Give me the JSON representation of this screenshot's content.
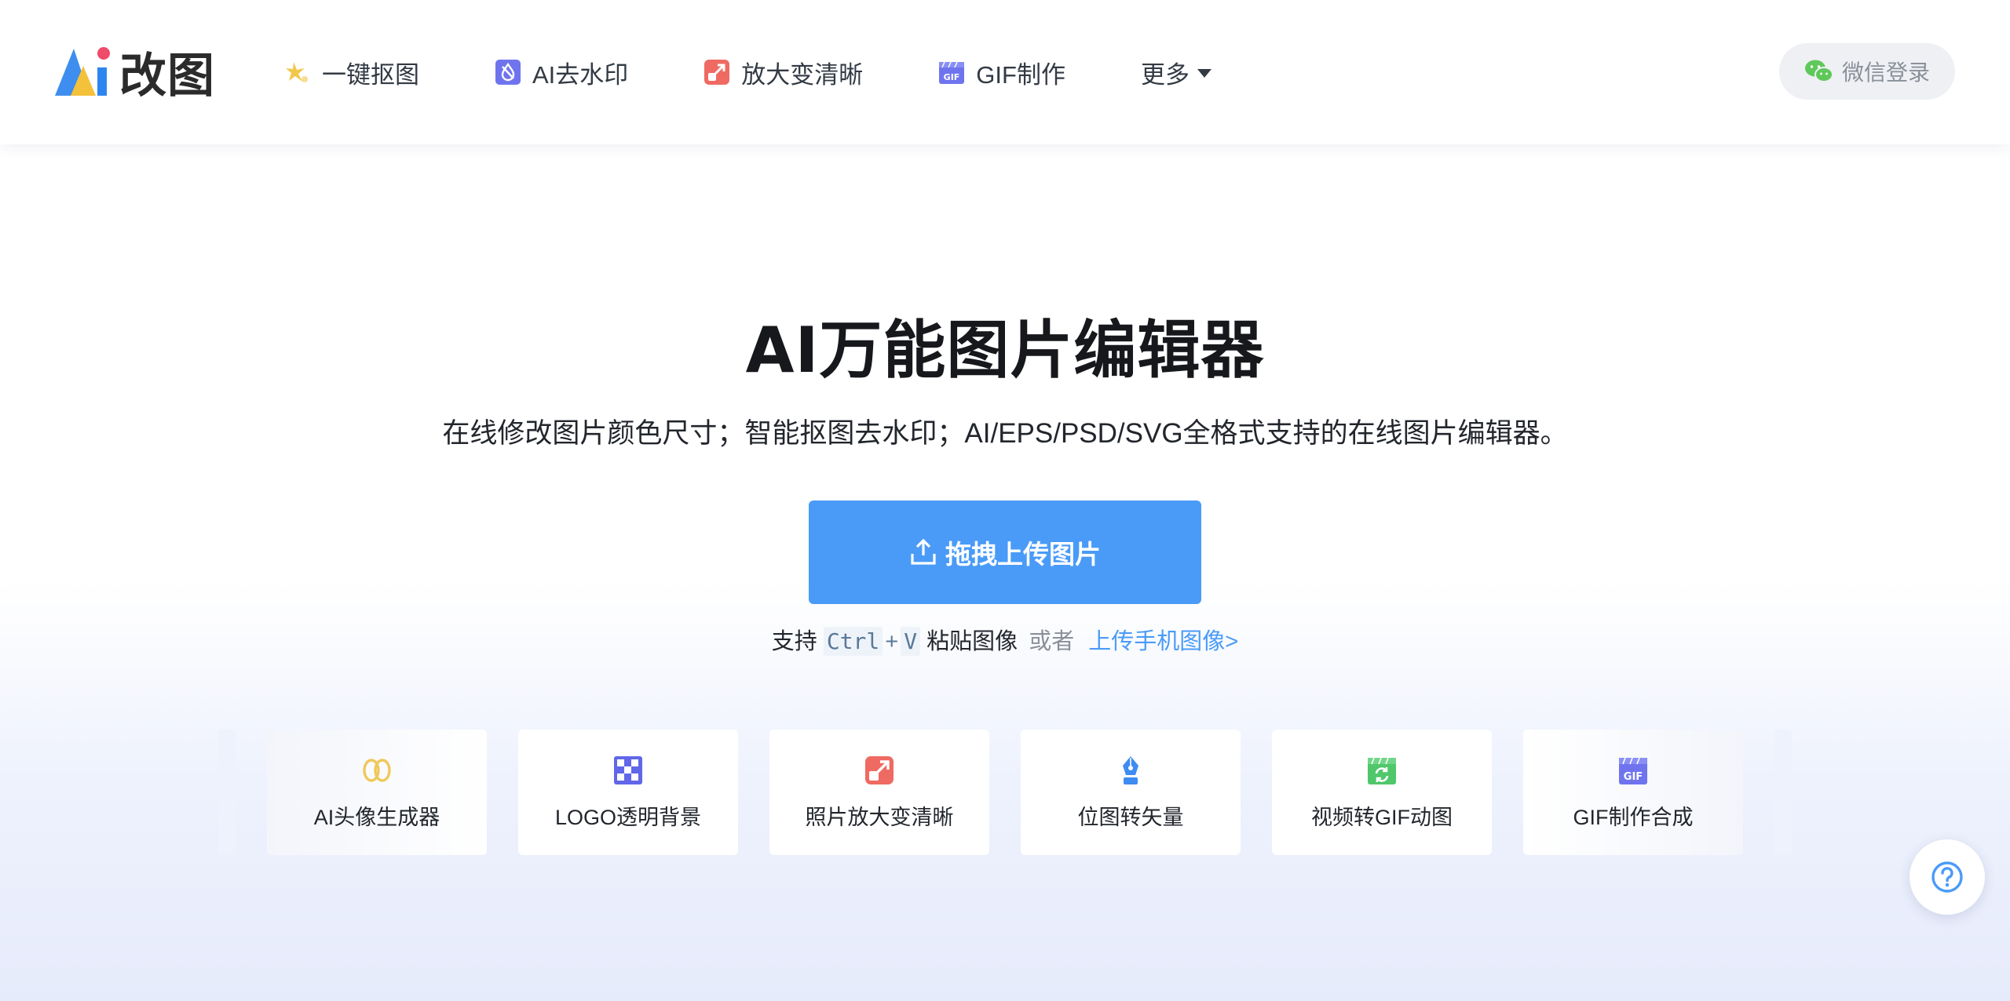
{
  "header": {
    "logo_text": "改图",
    "nav": [
      {
        "label": "一键抠图",
        "icon": "cutout-icon"
      },
      {
        "label": "AI去水印",
        "icon": "watermark-icon"
      },
      {
        "label": "放大变清晰",
        "icon": "enlarge-icon"
      },
      {
        "label": "GIF制作",
        "icon": "gif-icon"
      }
    ],
    "more_label": "更多",
    "login_label": "微信登录"
  },
  "hero": {
    "title": "AI万能图片编辑器",
    "subtitle": "在线修改图片颜色尺寸；智能抠图去水印；AI/EPS/PSD/SVG全格式支持的在线图片编辑器。",
    "upload_label": "拖拽上传图片",
    "paste": {
      "prefix": "支持",
      "key1": "Ctrl",
      "plus": "+",
      "key2": "V",
      "suffix": "粘贴图像",
      "or": "或者",
      "mobile_link": "上传手机图像>"
    }
  },
  "tools": [
    {
      "label": "AI头像生成器",
      "icon": "avatar-generator-icon"
    },
    {
      "label": "LOGO透明背景",
      "icon": "transparent-bg-icon"
    },
    {
      "label": "照片放大变清晰",
      "icon": "photo-enlarge-icon"
    },
    {
      "label": "位图转矢量",
      "icon": "vector-pen-icon"
    },
    {
      "label": "视频转GIF动图",
      "icon": "video-gif-icon"
    },
    {
      "label": "GIF制作合成",
      "icon": "gif-make-icon"
    }
  ],
  "colors": {
    "primary": "#4a9bf7",
    "title": "#16181c",
    "nav_text": "#333a44",
    "wechat_green": "#5fc85a"
  }
}
